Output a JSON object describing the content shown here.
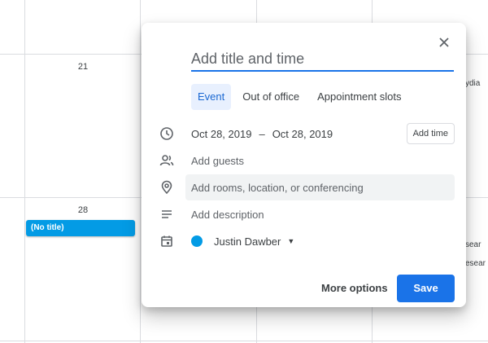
{
  "calendar": {
    "days": [
      "21",
      "28"
    ],
    "event_chip": "(No title)",
    "peek_texts": [
      "ydia",
      "sear",
      "esear"
    ]
  },
  "dialog": {
    "title_placeholder": "Add title and time",
    "tabs": [
      {
        "label": "Event",
        "active": true
      },
      {
        "label": "Out of office",
        "active": false
      },
      {
        "label": "Appointment slots",
        "active": false
      }
    ],
    "date_start": "Oct 28, 2019",
    "date_separator": "–",
    "date_end": "Oct 28, 2019",
    "add_time_label": "Add time",
    "guests_placeholder": "Add guests",
    "location_placeholder": "Add rooms, location, or conferencing",
    "description_placeholder": "Add description",
    "calendar_owner": "Justin Dawber",
    "calendar_color": "#039be5",
    "more_options_label": "More options",
    "save_label": "Save"
  },
  "icons": [
    "close-icon",
    "clock-icon",
    "people-icon",
    "location-icon",
    "description-icon",
    "calendar-icon",
    "chevron-down-icon"
  ],
  "colors": {
    "accent": "#1a73e8",
    "event": "#039be5",
    "tab_active_bg": "#e8f0fe"
  }
}
